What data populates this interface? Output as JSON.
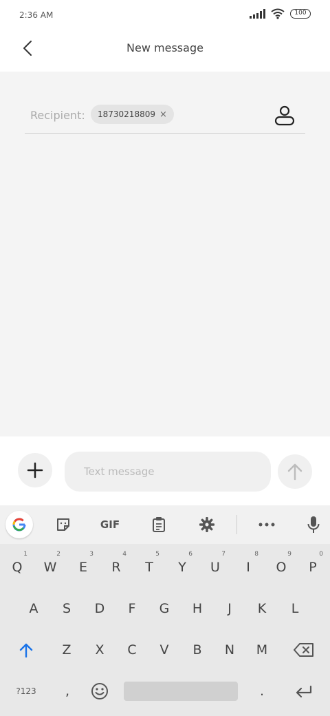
{
  "status_bar": {
    "time": "2:36 AM",
    "battery": "100",
    "signal_icon": "signal-icon",
    "wifi_icon": "wifi-icon"
  },
  "header": {
    "title": "New message",
    "back_icon": "back-arrow-icon"
  },
  "recipient": {
    "label": "Recipient:",
    "chip_value": "18730218809",
    "chip_remove": "×",
    "contact_icon": "contact-person-icon"
  },
  "compose": {
    "placeholder": "Text message",
    "add_icon": "plus-icon",
    "send_icon": "send-arrow-icon"
  },
  "keyboard": {
    "toolbar": {
      "google_icon": "google-g-icon",
      "sticker_icon": "sticker-icon",
      "gif_label": "GIF",
      "clipboard_icon": "clipboard-icon",
      "settings_icon": "gear-icon",
      "more_icon": "more-dots-icon",
      "mic_icon": "microphone-icon"
    },
    "row1": [
      "Q",
      "W",
      "E",
      "R",
      "T",
      "Y",
      "U",
      "I",
      "O",
      "P"
    ],
    "row1_hints": [
      "1",
      "2",
      "3",
      "4",
      "5",
      "6",
      "7",
      "8",
      "9",
      "0"
    ],
    "row2": [
      "A",
      "S",
      "D",
      "F",
      "G",
      "H",
      "J",
      "K",
      "L"
    ],
    "row3": [
      "Z",
      "X",
      "C",
      "V",
      "B",
      "N",
      "M"
    ],
    "shift_icon": "shift-arrow-icon",
    "backspace_icon": "backspace-icon",
    "symbols_label": "?123",
    "comma": ",",
    "emoji_icon": "emoji-icon",
    "period": ".",
    "enter_icon": "enter-icon"
  },
  "colors": {
    "accent_blue": "#1a73e8",
    "main_bg": "#f4f4f4",
    "keyboard_bg": "#e8e8e8"
  }
}
